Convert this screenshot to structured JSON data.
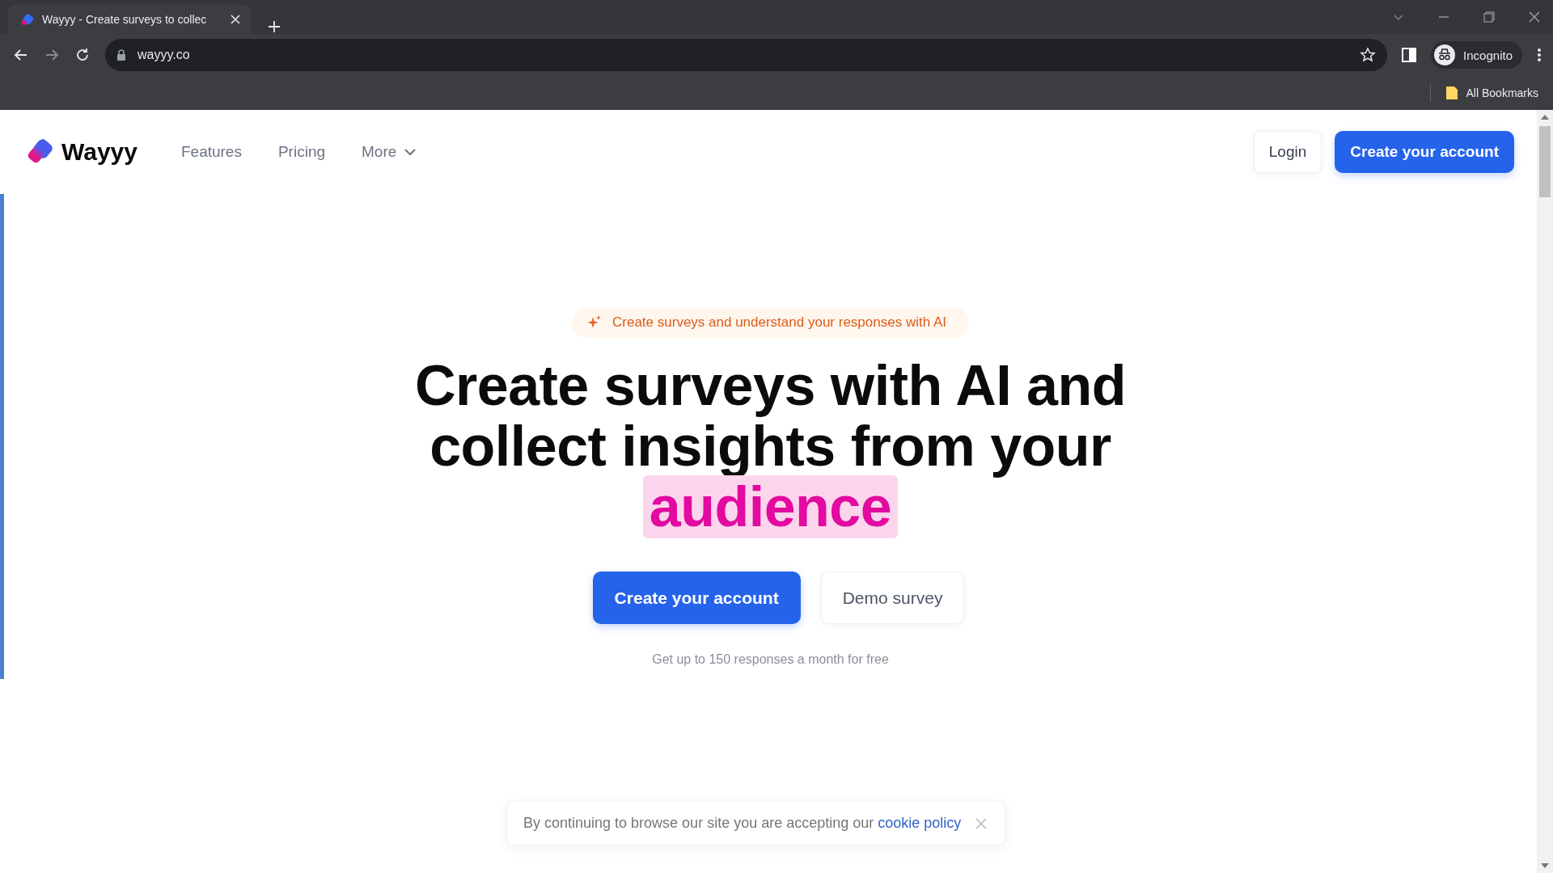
{
  "browser": {
    "tab": {
      "title": "Wayyy - Create surveys to collec"
    },
    "url": "wayyy.co",
    "profile": "Incognito",
    "bookmarks": "All Bookmarks"
  },
  "nav": {
    "brand": "Wayyy",
    "links": [
      "Features",
      "Pricing"
    ],
    "more": "More",
    "login": "Login",
    "cta": "Create your account"
  },
  "hero": {
    "badge": "Create surveys and understand your responses with AI",
    "headline": "Create surveys with AI and collect insights from your",
    "highlight": "audience",
    "primary": "Create your account",
    "secondary": "Demo survey",
    "note": "Get up to 150 responses a month for free"
  },
  "cookie": {
    "text": "By continuing to browse our site you are accepting our",
    "link": "cookie policy"
  }
}
